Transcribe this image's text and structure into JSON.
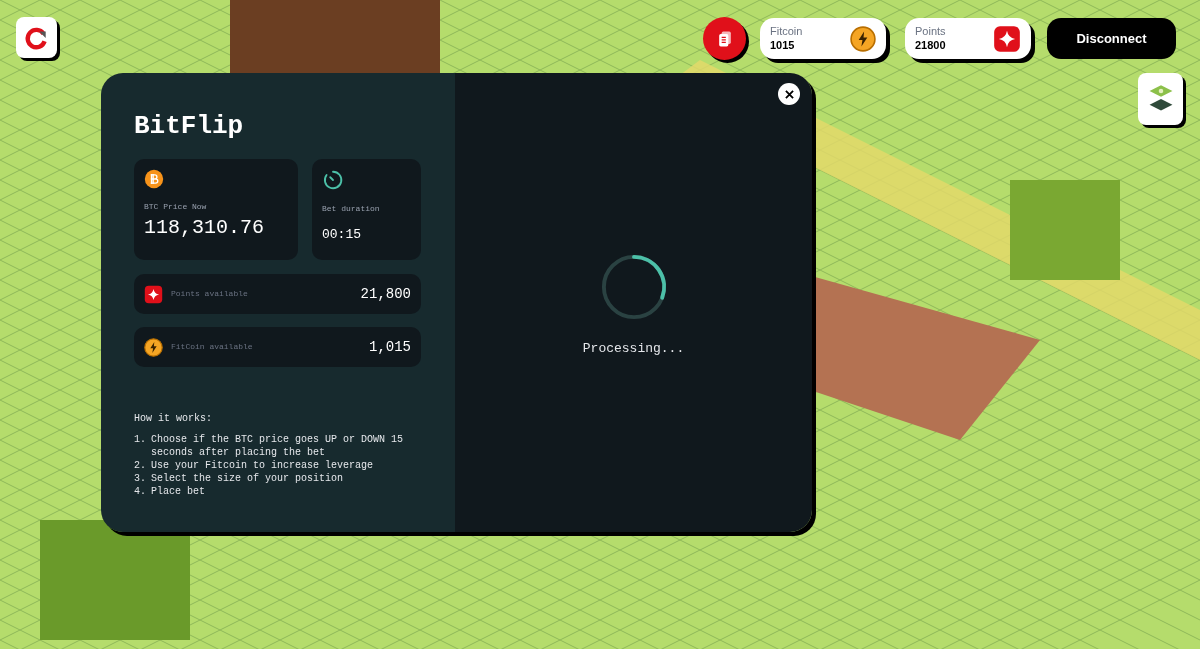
{
  "header": {
    "fitcoin": {
      "label": "Fitcoin",
      "value": "1015"
    },
    "points": {
      "label": "Points",
      "value": "21800"
    },
    "disconnect": "Disconnect"
  },
  "modal": {
    "title": "BitFlip",
    "price": {
      "label": "BTC Price Now",
      "value": "118,310.76"
    },
    "duration": {
      "label": "Bet duration",
      "value": "00:15"
    },
    "balances": [
      {
        "kind": "points",
        "label": "Points available",
        "value": "21,800"
      },
      {
        "kind": "fitcoin",
        "label": "FitCoin available",
        "value": "1,015"
      }
    ],
    "how_it_works": {
      "heading": "How it works:",
      "steps": [
        {
          "number": "1.",
          "text": "Choose if the BTC price goes UP or DOWN 15 seconds after placing the bet"
        },
        {
          "number": "2.",
          "text": "Use your Fitcoin to increase leverage"
        },
        {
          "number": "3.",
          "text": "Select the size of your position"
        },
        {
          "number": "4.",
          "text": "Place bet"
        }
      ]
    },
    "status": "Processing..."
  }
}
